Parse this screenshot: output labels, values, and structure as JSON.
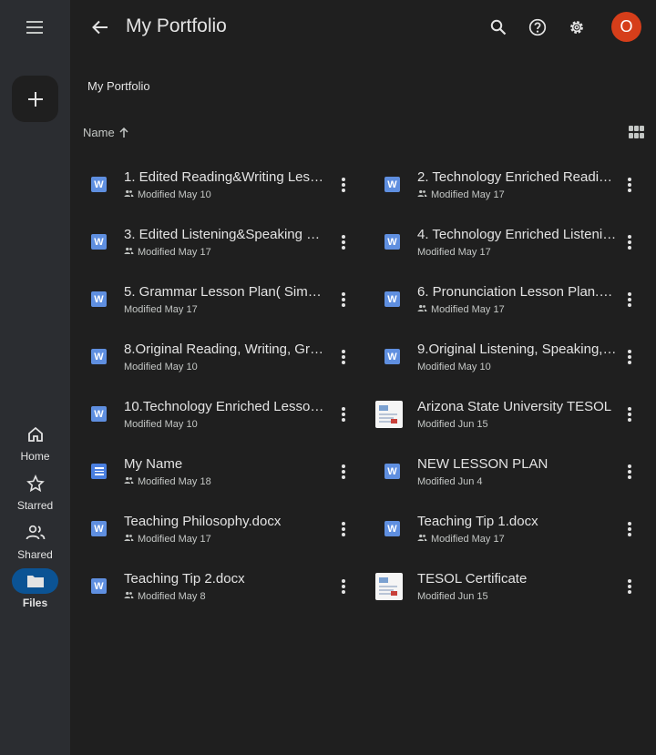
{
  "app": {
    "title": "My Portfolio",
    "breadcrumb": "My Portfolio",
    "avatar_initial": "O",
    "accent": "#0b5394",
    "avatar_color": "#d63e1a"
  },
  "nav": {
    "home": "Home",
    "starred": "Starred",
    "shared": "Shared",
    "files": "Files"
  },
  "sort": {
    "label": "Name"
  },
  "files": [
    {
      "name": "1. Edited Reading&Writing Lesson...",
      "meta": "Modified May 10",
      "shared": true,
      "type": "word"
    },
    {
      "name": "2. Technology Enriched Reading ...",
      "meta": "Modified May 17",
      "shared": true,
      "type": "word"
    },
    {
      "name": "3. Edited Listening&Speaking Les...",
      "meta": "Modified May 17",
      "shared": true,
      "type": "word"
    },
    {
      "name": "4. Technology Enriched Listening...",
      "meta": "Modified May 17",
      "shared": false,
      "type": "word"
    },
    {
      "name": "5. Grammar Lesson Plan( Simpl P...",
      "meta": "Modified May 17",
      "shared": false,
      "type": "word"
    },
    {
      "name": "6. Pronunciation Lesson Plan.docx",
      "meta": "Modified May 17",
      "shared": true,
      "type": "word"
    },
    {
      "name": "8.Original Reading, Writing, Gra...",
      "meta": "Modified May 10",
      "shared": false,
      "type": "word"
    },
    {
      "name": "9.Original Listening, Speaking, Pr...",
      "meta": "Modified May 10",
      "shared": false,
      "type": "word"
    },
    {
      "name": "10.Technology Enriched Lesson P...",
      "meta": "Modified May 10",
      "shared": false,
      "type": "word"
    },
    {
      "name": "Arizona State University TESOL",
      "meta": "Modified Jun 15",
      "shared": false,
      "type": "image"
    },
    {
      "name": "My Name",
      "meta": "Modified May 18",
      "shared": true,
      "type": "gdoc"
    },
    {
      "name": "NEW LESSON PLAN",
      "meta": "Modified Jun 4",
      "shared": false,
      "type": "word"
    },
    {
      "name": "Teaching Philosophy.docx",
      "meta": "Modified May 17",
      "shared": true,
      "type": "word"
    },
    {
      "name": "Teaching Tip 1.docx",
      "meta": "Modified May 17",
      "shared": true,
      "type": "word"
    },
    {
      "name": "Teaching Tip 2.docx",
      "meta": "Modified May 8",
      "shared": true,
      "type": "word"
    },
    {
      "name": "TESOL Certificate",
      "meta": "Modified Jun 15",
      "shared": false,
      "type": "image"
    }
  ]
}
